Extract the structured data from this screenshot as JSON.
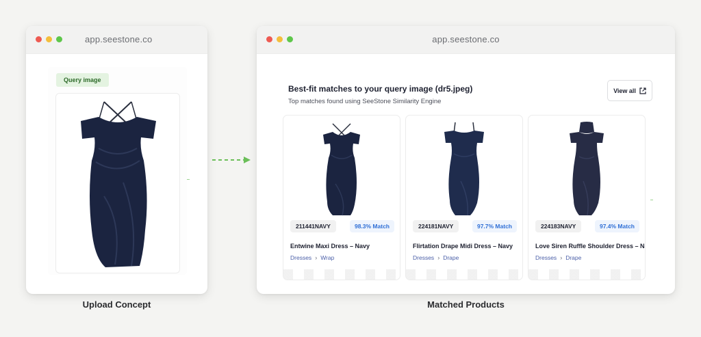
{
  "left_window": {
    "url": "app.seestone.co",
    "badge": "Query image"
  },
  "right_window": {
    "url": "app.seestone.co",
    "title": "Best-fit matches to your query image (dr5.jpeg)",
    "subtitle": "Top matches found using SeeStone Similarity Engine",
    "view_all": "View all",
    "products": [
      {
        "sku": "211441NAVY",
        "match": "98.3% Match",
        "name": "Entwine Maxi Dress – Navy",
        "category": "Dresses",
        "subcategory": "Wrap"
      },
      {
        "sku": "224181NAVY",
        "match": "97.7% Match",
        "name": "Flirtation Drape Midi Dress – Navy",
        "category": "Dresses",
        "subcategory": "Drape"
      },
      {
        "sku": "224183NAVY",
        "match": "97.4% Match",
        "name": "Love Siren Ruffle Shoulder Dress – Navy",
        "category": "Dresses",
        "subcategory": "Drape"
      }
    ]
  },
  "captions": {
    "left": "Upload Concept",
    "right": "Matched Products"
  },
  "colors": {
    "dress_navy": "#1b2440",
    "accent_green": "#6bbf59",
    "match_blue": "#2f6fd6"
  },
  "icons": {
    "view_all": "external-link-icon",
    "flow_arrow": "dashed-arrow-right-icon"
  }
}
